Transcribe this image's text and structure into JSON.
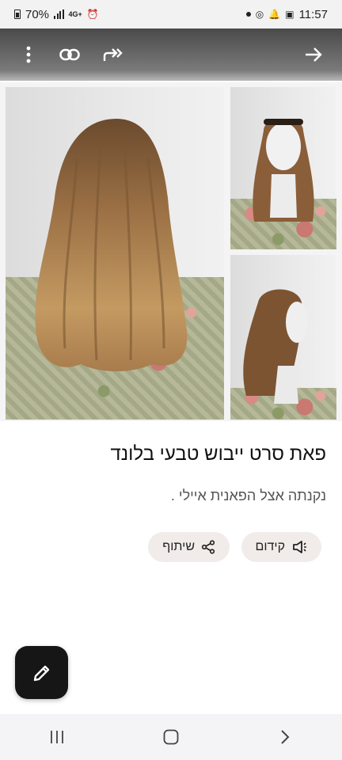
{
  "status_bar": {
    "battery": "70%",
    "network": "4G+",
    "time": "11:57"
  },
  "toolbar": {
    "icons": [
      "more-vert-icon",
      "link-icon",
      "forward-all-icon",
      "arrow-forward-icon"
    ]
  },
  "photos": {
    "count": 3
  },
  "listing": {
    "title": "פאת סרט ייבוש טבעי בלונד",
    "subtitle": "נקנתה אצל הפאנית  איילי ."
  },
  "actions": {
    "promote_label": "קידום",
    "share_label": "שיתוף"
  },
  "fab": {
    "icon": "pencil-icon"
  },
  "nav_bar": {
    "icons": [
      "recents-icon",
      "home-icon",
      "back-icon"
    ]
  },
  "colors": {
    "chip_bg": "#f1ece9",
    "fab_bg": "#161616",
    "toolbar_top": "#4a4a4a"
  }
}
